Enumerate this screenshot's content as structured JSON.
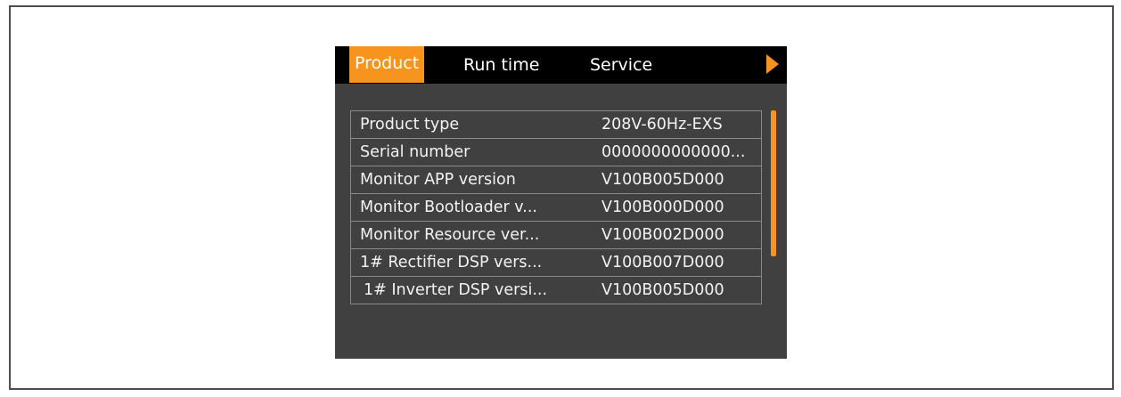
{
  "tabs": [
    "Product",
    "Run time",
    "Service"
  ],
  "accent_color": "#f7941d",
  "nav_icon": "right-arrow-icon",
  "rows": [
    {
      "label": "Product type",
      "value": "208V-60Hz-EXS"
    },
    {
      "label": "Serial number",
      "value": "0000000000000..."
    },
    {
      "label": "Monitor APP version",
      "value": "V100B005D000"
    },
    {
      "label": "Monitor Bootloader v...",
      "value": "V100B000D000"
    },
    {
      "label": "Monitor Resource ver...",
      "value": "V100B002D000"
    },
    {
      "label": "1# Rectifier DSP vers...",
      "value": "V100B007D000"
    },
    {
      "label": "1# Inverter DSP versi...",
      "value": "V100B005D000"
    }
  ]
}
